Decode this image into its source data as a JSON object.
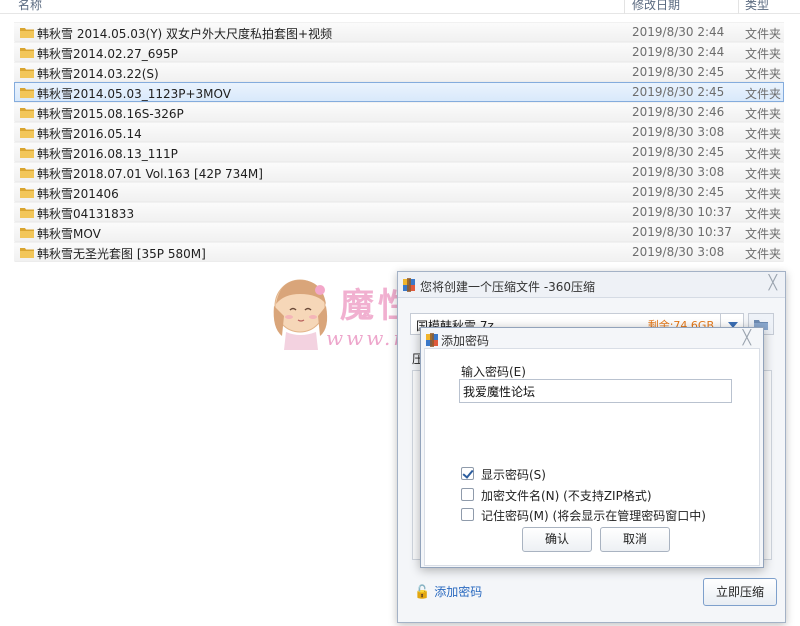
{
  "explorer": {
    "columns": {
      "name": "名称",
      "date": "修改日期",
      "type": "类型"
    },
    "rows": [
      {
        "name": "韩秋雪 2014.05.03(Y) 双女户外大尺度私拍套图+视频",
        "date": "2019/8/30 2:44",
        "type": "文件夹"
      },
      {
        "name": "韩秋雪2014.02.27_695P",
        "date": "2019/8/30 2:44",
        "type": "文件夹"
      },
      {
        "name": "韩秋雪2014.03.22(S)",
        "date": "2019/8/30 2:45",
        "type": "文件夹"
      },
      {
        "name": "韩秋雪2014.05.03_1123P+3MOV",
        "date": "2019/8/30 2:45",
        "type": "文件夹"
      },
      {
        "name": "韩秋雪2015.08.16S-326P",
        "date": "2019/8/30 2:46",
        "type": "文件夹"
      },
      {
        "name": "韩秋雪2016.05.14",
        "date": "2019/8/30 3:08",
        "type": "文件夹"
      },
      {
        "name": "韩秋雪2016.08.13_111P",
        "date": "2019/8/30 2:45",
        "type": "文件夹"
      },
      {
        "name": "韩秋雪2018.07.01 Vol.163 [42P 734M]",
        "date": "2019/8/30 3:08",
        "type": "文件夹"
      },
      {
        "name": "韩秋雪201406",
        "date": "2019/8/30 2:45",
        "type": "文件夹"
      },
      {
        "name": "韩秋雪04131833",
        "date": "2019/8/30 10:37",
        "type": "文件夹"
      },
      {
        "name": "韩秋雪MOV",
        "date": "2019/8/30 10:37",
        "type": "文件夹"
      },
      {
        "name": "韩秋雪无圣光套图 [35P 580M]",
        "date": "2019/8/30 3:08",
        "type": "文件夹"
      }
    ],
    "selected_index": 3
  },
  "watermark": {
    "title": "魔性论坛",
    "url": "www.moxing.cool"
  },
  "compress_dialog": {
    "title": "您将创建一个压缩文件 -360压缩",
    "path": "国模韩秋雪.7z",
    "free_space": "剩余:74.6GB",
    "compress_label": "压",
    "add_password_link": "添加密码",
    "compress_button": "立即压缩",
    "close_glyph": "╳"
  },
  "password_dialog": {
    "title": "添加密码",
    "input_label": "输入密码(E)",
    "password_value": "我爱魔性论坛",
    "options": [
      {
        "label": "显示密码(S)",
        "checked": true
      },
      {
        "label": "加密文件名(N) (不支持ZIP格式)",
        "checked": false
      },
      {
        "label": "记住密码(M) (将会显示在管理密码窗口中)",
        "checked": false
      }
    ],
    "ok_button": "确认",
    "cancel_button": "取消",
    "close_glyph": "╳"
  },
  "colors": {
    "selection_border": "#84acdd",
    "selection_fill": "#d9e9fb",
    "free_space": "#e67817",
    "link": "#2a6ac0",
    "watermark": "#f0a8cc"
  }
}
